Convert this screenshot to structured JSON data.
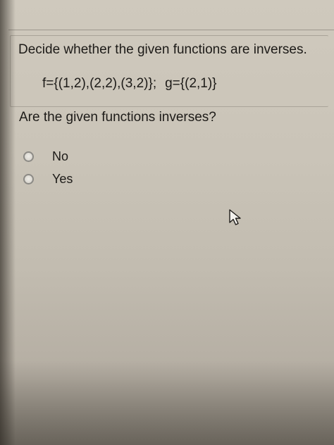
{
  "question": {
    "instructions": "Decide whether the given functions are inverses.",
    "function_f": "f={(1,2),(2,2),(3,2)};",
    "function_g": "g={(2,1)}",
    "prompt": "Are the given functions inverses?"
  },
  "options": [
    {
      "label": "No",
      "selected": false
    },
    {
      "label": "Yes",
      "selected": false
    }
  ],
  "cursor": {
    "icon": "mouse-pointer-icon"
  }
}
